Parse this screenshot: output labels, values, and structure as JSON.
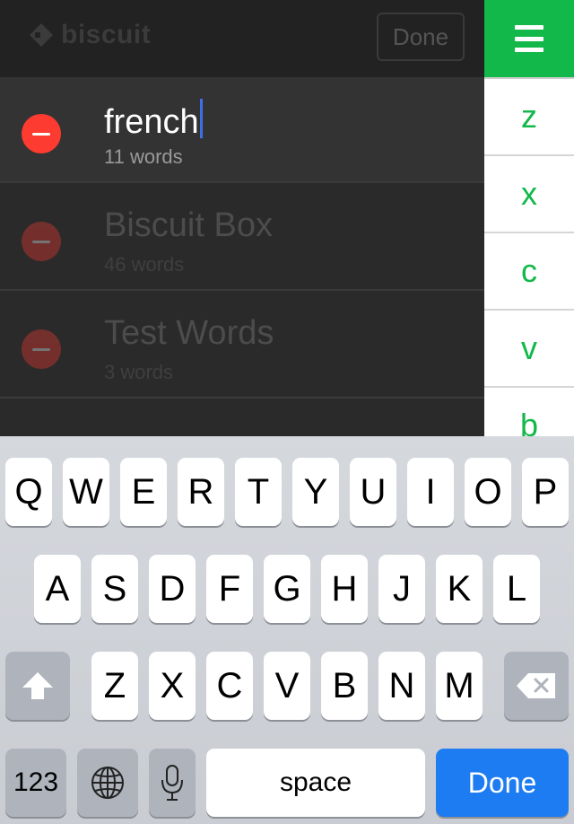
{
  "header": {
    "logo_text": "biscuit",
    "done_label": "Done"
  },
  "lists": [
    {
      "title": "french",
      "subtitle": "11 words",
      "editing": true
    },
    {
      "title": "Biscuit Box",
      "subtitle": "46 words",
      "editing": false
    },
    {
      "title": "Test Words",
      "subtitle": "3 words",
      "editing": false
    }
  ],
  "index_bar": {
    "letters": [
      "z",
      "x",
      "c",
      "v",
      "b"
    ]
  },
  "keyboard": {
    "row1": [
      "Q",
      "W",
      "E",
      "R",
      "T",
      "Y",
      "U",
      "I",
      "O",
      "P"
    ],
    "row2": [
      "A",
      "S",
      "D",
      "F",
      "G",
      "H",
      "J",
      "K",
      "L"
    ],
    "row3": [
      "Z",
      "X",
      "C",
      "V",
      "B",
      "N",
      "M"
    ],
    "numbers_label": "123",
    "space_label": "space",
    "done_label": "Done"
  },
  "colors": {
    "accent_green": "#12b84a",
    "delete_red": "#fd3b30",
    "caret_blue": "#3f6fe6",
    "keyboard_done_blue": "#1d7cf2"
  },
  "icons": {
    "menu": "hamburger-menu-icon",
    "logo": "biscuit-logo-icon",
    "delete": "minus-circle-icon",
    "shift": "shift-arrow-icon",
    "backspace": "backspace-icon",
    "globe": "globe-icon",
    "mic": "microphone-icon"
  }
}
